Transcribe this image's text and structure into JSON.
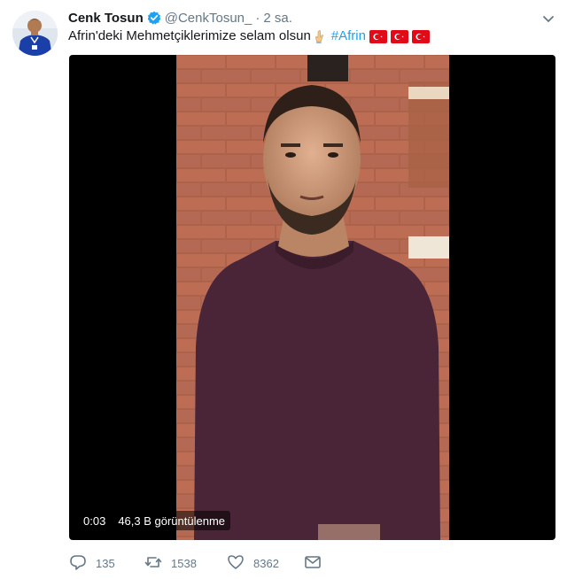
{
  "tweet": {
    "author": {
      "name": "Cenk Tosun",
      "handle": "@CenkTosun_",
      "time": "2 sa."
    },
    "text": "Afrin'deki Mehmetçiklerimize selam olsun",
    "hashtag": "#Afrin",
    "icons": {
      "verified": "verified-badge-icon",
      "hands": "folded-hands-emoji",
      "flag": "turkey-flag-emoji",
      "caret": "chevron-down-icon"
    }
  },
  "video": {
    "duration": "0:03",
    "views": "46,3 B görüntülenme"
  },
  "actions": {
    "reply_count": "135",
    "retweet_count": "1538",
    "like_count": "8362"
  },
  "colors": {
    "link": "#1da1f2",
    "muted": "#657786",
    "verified": "#1da1f2",
    "flag_red": "#e30a17"
  }
}
